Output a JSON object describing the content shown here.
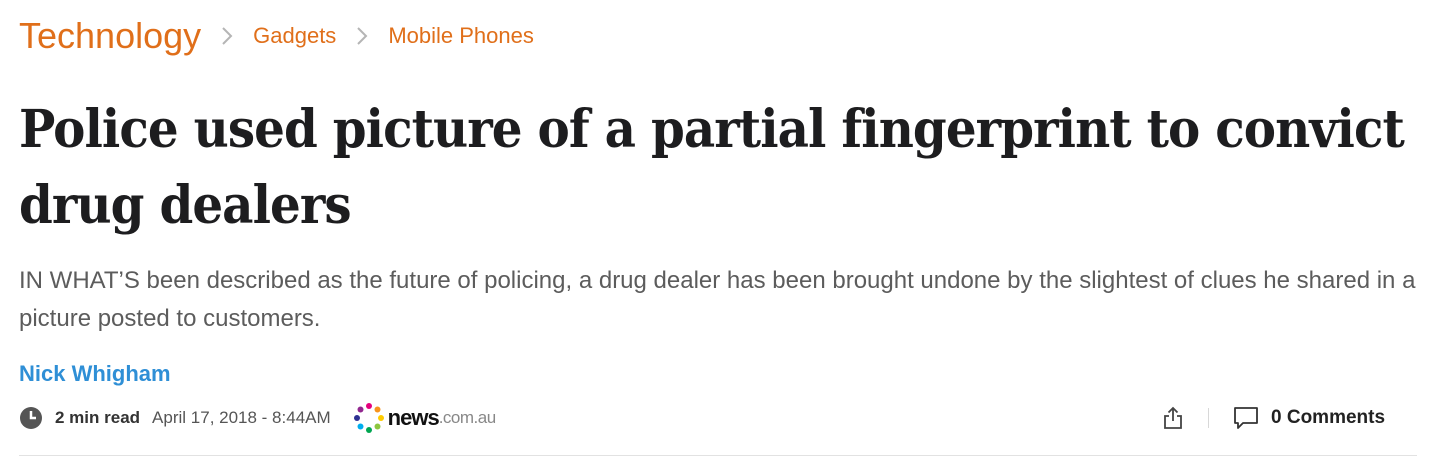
{
  "breadcrumb": {
    "items": [
      {
        "label": "Technology"
      },
      {
        "label": "Gadgets"
      },
      {
        "label": "Mobile Phones"
      }
    ]
  },
  "article": {
    "headline_line1": "Police used picture of a partial fingerprint to convict",
    "headline_line2": "drug dealers",
    "standfirst": "IN WHAT’S been described as the future of policing, a drug dealer has been brought undone by the slightest of clues he shared in a picture posted to customers.",
    "author": "Nick Whigham",
    "read_time": "2 min read",
    "date": "April 17, 2018 - 8:44AM"
  },
  "publisher": {
    "logo_news": "news",
    "logo_domain": ".com.au"
  },
  "actions": {
    "share_icon": "share-icon",
    "comments_label": "0 Comments"
  },
  "colors": {
    "breadcrumb": "#e06f1a",
    "author": "#2f8fd6",
    "headline": "#1d1d1f",
    "standfirst": "#5c5c5c"
  }
}
